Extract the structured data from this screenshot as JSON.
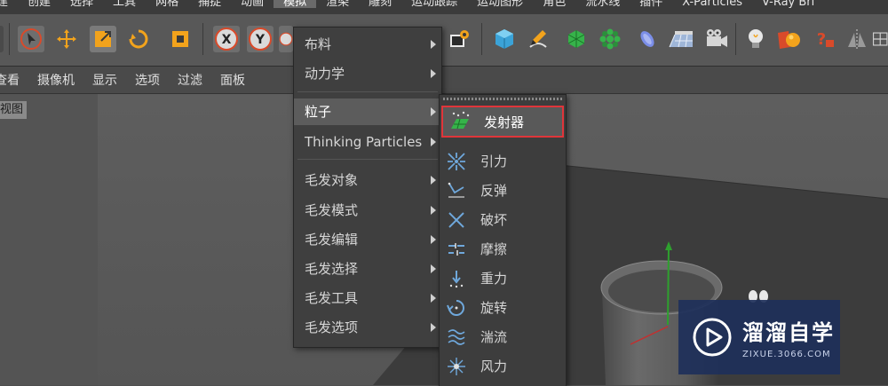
{
  "menubar": {
    "items": [
      "建",
      "创建",
      "选择",
      "工具",
      "网格",
      "捕捉",
      "动画",
      "模拟",
      "渲染",
      "雕刻",
      "运动跟踪",
      "运动图形",
      "角色",
      "流水线",
      "插件",
      "X-Particles",
      "V-Ray Bri"
    ],
    "active": "模拟"
  },
  "subbar": {
    "items": [
      "查看",
      "摄像机",
      "显示",
      "选项",
      "过滤",
      "面板"
    ]
  },
  "viewport": {
    "label": "视图"
  },
  "simulate_menu": {
    "items": [
      {
        "label": "布料",
        "submenu": true
      },
      {
        "label": "动力学",
        "submenu": true
      },
      {
        "label": "粒子",
        "submenu": true,
        "highlighted": true
      },
      {
        "label": "Thinking Particles",
        "submenu": true
      },
      {
        "label": "毛发对象",
        "submenu": true
      },
      {
        "label": "毛发模式",
        "submenu": true
      },
      {
        "label": "毛发编辑",
        "submenu": true
      },
      {
        "label": "毛发选择",
        "submenu": true
      },
      {
        "label": "毛发工具",
        "submenu": true
      },
      {
        "label": "毛发选项",
        "submenu": true
      }
    ]
  },
  "particles_menu": {
    "emitter": {
      "label": "发射器",
      "icon": "emitter-icon"
    },
    "items": [
      {
        "label": "引力",
        "icon": "attractor-icon"
      },
      {
        "label": "反弹",
        "icon": "deflector-icon"
      },
      {
        "label": "破坏",
        "icon": "destructor-icon"
      },
      {
        "label": "摩擦",
        "icon": "friction-icon"
      },
      {
        "label": "重力",
        "icon": "gravity-icon"
      },
      {
        "label": "旋转",
        "icon": "rotation-icon"
      },
      {
        "label": "湍流",
        "icon": "turbulence-icon"
      },
      {
        "label": "风力",
        "icon": "wind-icon"
      }
    ]
  },
  "watermark": {
    "title": "溜溜自学",
    "url": "ZIXUE.3066.COM"
  },
  "colors": {
    "highlight_border": "#e0353a",
    "watermark_bg": "#1e305a"
  }
}
